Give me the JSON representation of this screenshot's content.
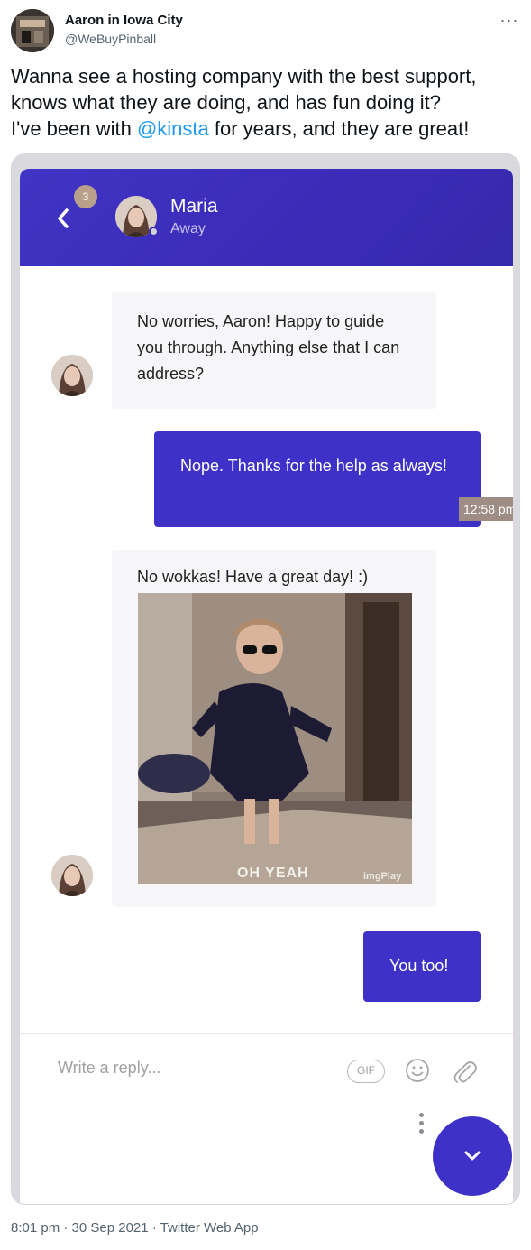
{
  "tweet": {
    "author_name": "Aaron in Iowa City",
    "author_handle": "@WeBuyPinball",
    "more_label": "···",
    "text_before": "Wanna see a hosting company with the best support, knows what they are doing, and has fun doing it?\nI've been with ",
    "mention": "@kinsta",
    "text_after": " for years, and they are great!",
    "footer": "8:01 pm · 30 Sep 2021 · Twitter Web App"
  },
  "chat": {
    "header": {
      "badge_count": "3",
      "agent_name": "Maria",
      "agent_status": "Away"
    },
    "messages": [
      {
        "from": "agent",
        "text": "No worries, Aaron! Happy to guide you through. Anything else that I can address?"
      },
      {
        "from": "user",
        "text": "Nope. Thanks for the help as always!",
        "time": "12:58 pm"
      },
      {
        "from": "agent",
        "text": "No wokkas! Have a great day! :)",
        "gif_caption": "OH YEAH",
        "gif_watermark": "imgPlay"
      },
      {
        "from": "user",
        "text": "You too!"
      }
    ],
    "reply": {
      "placeholder": "Write a reply...",
      "gif_label": "GIF"
    },
    "colors": {
      "accent": "#3d31c8",
      "header": "#3a2bb7",
      "agent_bubble": "#f6f6f8"
    }
  }
}
